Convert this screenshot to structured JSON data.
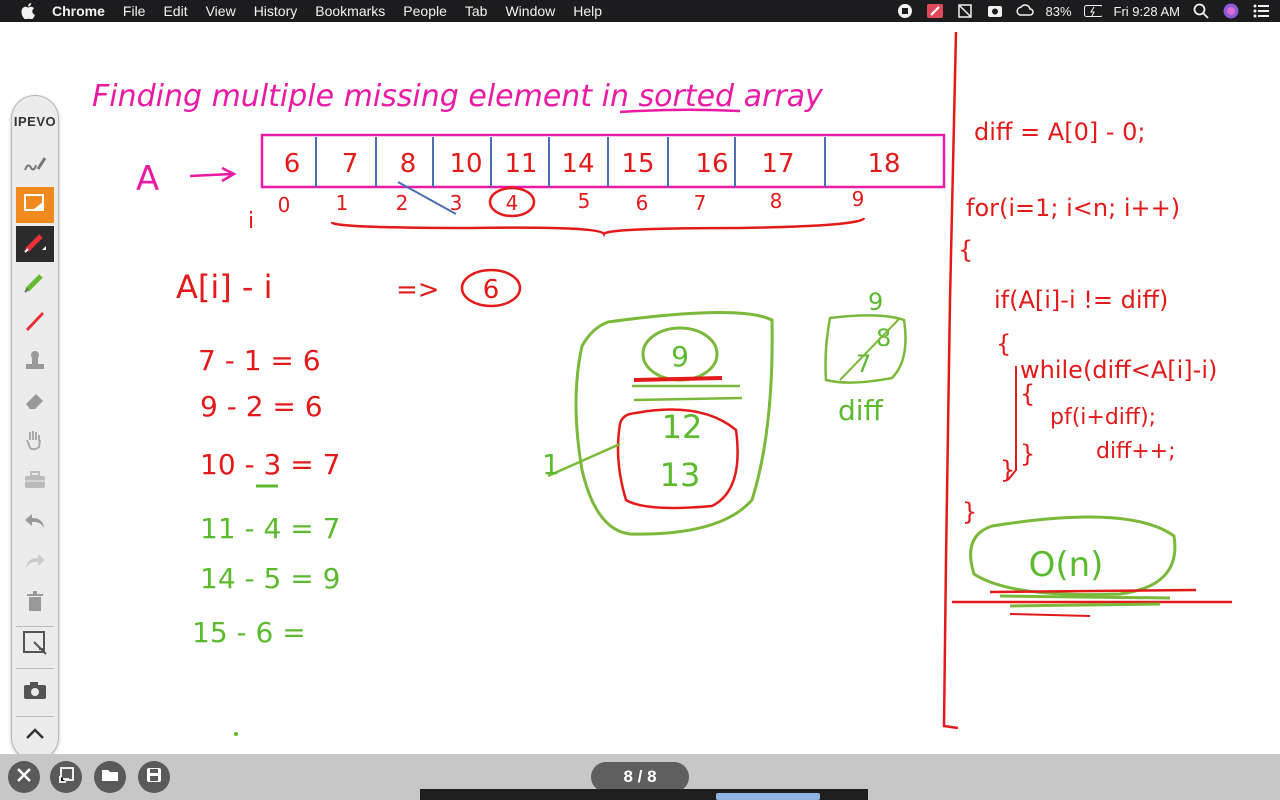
{
  "menubar": {
    "app_name": "Chrome",
    "items": [
      "File",
      "Edit",
      "View",
      "History",
      "Bookmarks",
      "People",
      "Tab",
      "Window",
      "Help"
    ],
    "battery": "83%",
    "clock": "Fri 9:28 AM"
  },
  "toolbar": {
    "brand": "IPEVO",
    "tools": [
      "handwriting-icon",
      "selection-icon",
      "red-pen-icon",
      "green-pen-icon",
      "red-line-icon",
      "stamp-icon",
      "eraser-icon",
      "hand-icon",
      "toolbox-icon",
      "undo-icon",
      "redo-icon",
      "trash-icon",
      "capture-icon",
      "camera-icon",
      "chevron-up-icon"
    ]
  },
  "board": {
    "title": "Finding multiple missing element in sorted array",
    "array_label": "A",
    "array_values": [
      "6",
      "7",
      "8",
      "10",
      "11",
      "14",
      "15",
      "16",
      "17",
      "18"
    ],
    "index_label": "i",
    "indices": [
      "0",
      "1",
      "2",
      "3",
      "4",
      "5",
      "6",
      "7",
      "8",
      "9"
    ],
    "expr": "A[i] - i",
    "arrow": "=>",
    "result": "6",
    "calcs": [
      "7 - 1 = 6",
      "9 - 2 = 6",
      "10 - 3 = 7",
      "11 - 4 = 7",
      "14 - 5 = 9",
      "15 - 6 ="
    ],
    "missing_box": [
      "9",
      "12",
      "13"
    ],
    "missing_box_side": "1",
    "diff_box_top": "9",
    "diff_box_values": [
      "8",
      "7"
    ],
    "diff_box_label": "diff",
    "code": [
      "diff = A[0] - 0;",
      "for(i=1; i<n; i++)",
      "{",
      "if(A[i]-i != diff)",
      "{",
      "while(diff<A[i]-i)",
      "{",
      "pf(i+diff);",
      "diff++;",
      "}",
      "}",
      "}"
    ],
    "complexity": "O(n)"
  },
  "bottom": {
    "page_indicator": "8 / 8"
  }
}
